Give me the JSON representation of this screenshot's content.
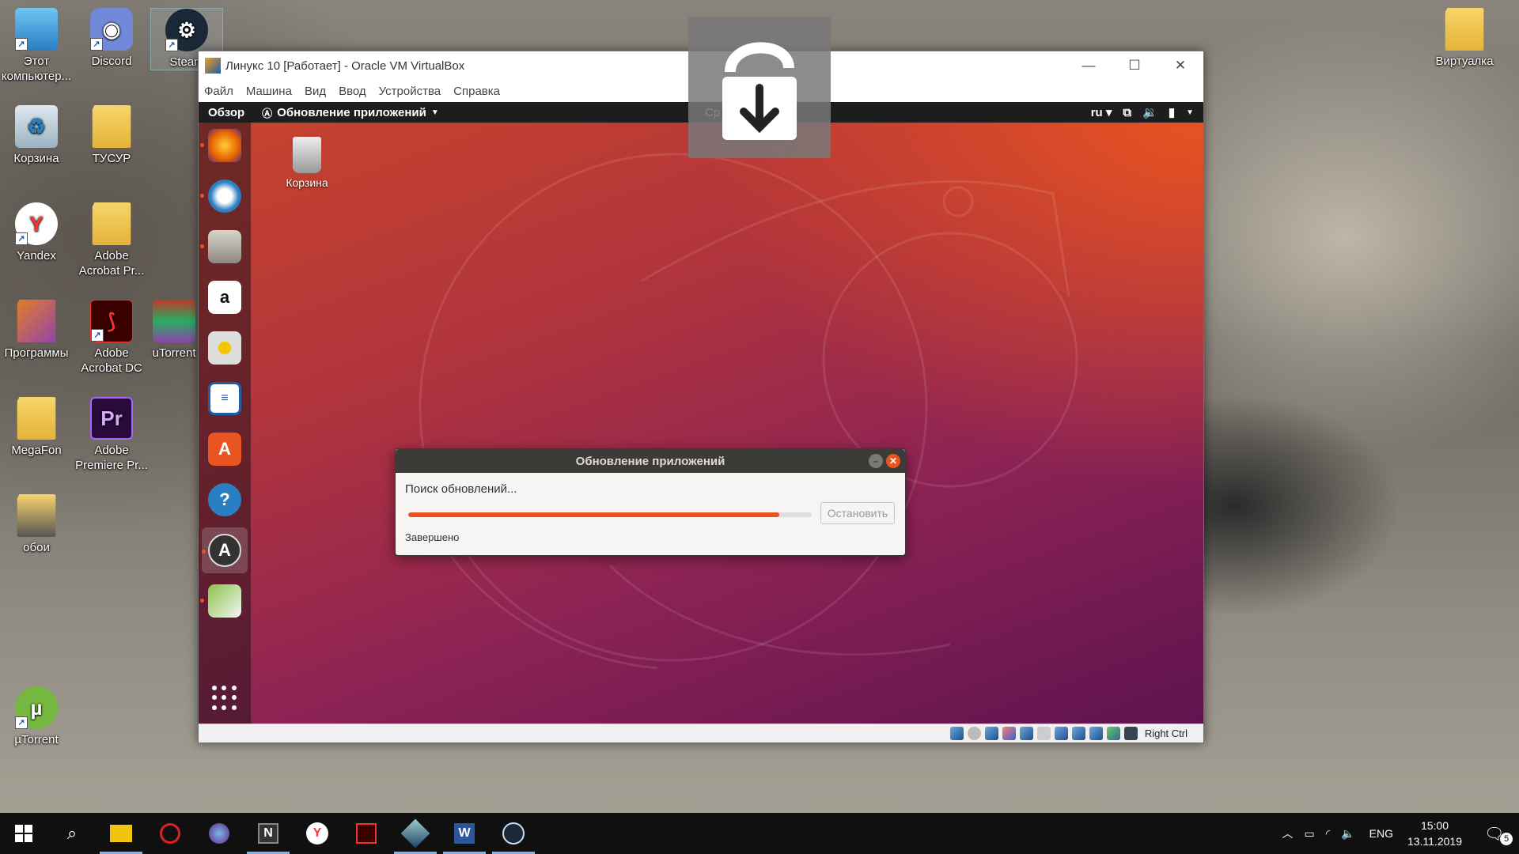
{
  "desktop": {
    "icons": [
      {
        "label": "Этот компьютер..."
      },
      {
        "label": "Discord"
      },
      {
        "label": "Steam"
      },
      {
        "label": "Корзина"
      },
      {
        "label": "ТУСУР"
      },
      {
        "label": "Yandex"
      },
      {
        "label": "Adobe Acrobat Pr..."
      },
      {
        "label": "Программы"
      },
      {
        "label": "Adobe Acrobat DC"
      },
      {
        "label": "uTorrent"
      },
      {
        "label": "MegaFon"
      },
      {
        "label": "Adobe Premiere Pr..."
      },
      {
        "label": "обои"
      },
      {
        "label": "µTorrent"
      },
      {
        "label": "Виртуалка"
      }
    ]
  },
  "vbox": {
    "title": "Линукс 10 [Работает] - Oracle VM VirtualBox",
    "menu": [
      "Файл",
      "Машина",
      "Вид",
      "Ввод",
      "Устройства",
      "Справка"
    ],
    "status_hostkey": "Right Ctrl"
  },
  "ubuntu": {
    "overview": "Обзор",
    "app_menu": "Обновление приложений",
    "clock_partial": "Ср",
    "lang": "ru",
    "desktop_trash": "Корзина",
    "dock": [
      "firefox",
      "thunderbird",
      "files",
      "amazon",
      "rhythmbox",
      "libreoffice-writer",
      "software-center",
      "help",
      "software-updater",
      "image-viewer"
    ]
  },
  "dialog": {
    "title": "Обновление приложений",
    "message": "Поиск обновлений...",
    "stop_button": "Остановить",
    "status": "Завершено",
    "progress": 0.92
  },
  "taskbar": {
    "lang": "ENG",
    "time": "15:00",
    "date": "13.11.2019",
    "notifications": "5"
  },
  "colors": {
    "ubuntu_orange": "#e95420",
    "vb_overlay": "#787878"
  }
}
